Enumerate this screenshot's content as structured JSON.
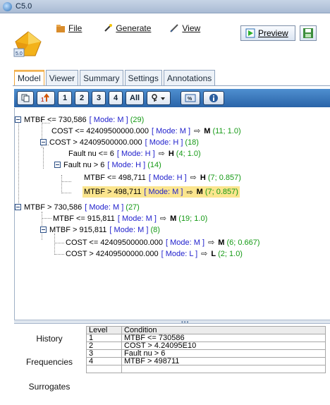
{
  "window": {
    "title": "C5.0"
  },
  "menu": [
    {
      "key": "file",
      "label": "File"
    },
    {
      "key": "generate",
      "label": "Generate"
    },
    {
      "key": "view",
      "label": "View"
    }
  ],
  "toolbar": {
    "preview_label": "Preview"
  },
  "tabs": [
    "Model",
    "Viewer",
    "Summary",
    "Settings",
    "Annotations"
  ],
  "tree_toolbar": {
    "levels": [
      "1",
      "2",
      "3",
      "4",
      "All"
    ]
  },
  "tree": [
    {
      "cond": "MTBF <= 730,586",
      "mode": "[ Mode: M ]",
      "count": "(29)",
      "pred": "",
      "stats": "",
      "expand": true
    },
    {
      "cond": "COST <= 42409500000.000",
      "mode": "[ Mode: M ]",
      "count": "",
      "pred": "M",
      "stats": "(11; 1.0)",
      "expand": false
    },
    {
      "cond": "COST > 42409500000.000",
      "mode": "[ Mode: H ]",
      "count": "(18)",
      "pred": "",
      "stats": "",
      "expand": true
    },
    {
      "cond": "Fault nu <= 6",
      "mode": "[ Mode: H ]",
      "count": "",
      "pred": "H",
      "stats": "(4; 1.0)",
      "expand": false
    },
    {
      "cond": "Fault nu > 6",
      "mode": "[ Mode: H ]",
      "count": "(14)",
      "pred": "",
      "stats": "",
      "expand": true
    },
    {
      "cond": "MTBF <= 498,711",
      "mode": "[ Mode: H ]",
      "count": "",
      "pred": "H",
      "stats": "(7; 0.857)",
      "expand": false
    },
    {
      "cond": "MTBF > 498,711",
      "mode": "[ Mode: M ]",
      "count": "",
      "pred": "M",
      "stats": "(7; 0.857)",
      "expand": false,
      "highlight": true
    },
    {
      "cond": "MTBF > 730,586",
      "mode": "[ Mode: M ]",
      "count": "(27)",
      "pred": "",
      "stats": "",
      "expand": true
    },
    {
      "cond": "MTBF <= 915,811",
      "mode": "[ Mode: M ]",
      "count": "",
      "pred": "M",
      "stats": "(19; 1.0)",
      "expand": false
    },
    {
      "cond": "MTBF > 915,811",
      "mode": "[ Mode: M ]",
      "count": "(8)",
      "pred": "",
      "stats": "",
      "expand": true
    },
    {
      "cond": "COST <= 42409500000.000",
      "mode": "[ Mode: M ]",
      "count": "",
      "pred": "M",
      "stats": "(6; 0.667)",
      "expand": false
    },
    {
      "cond": "COST > 42409500000.000",
      "mode": "[ Mode: L ]",
      "count": "",
      "pred": "L",
      "stats": "(2; 1.0)",
      "expand": false
    }
  ],
  "side_buttons": [
    "History",
    "Frequencies",
    "Surrogates"
  ],
  "table": {
    "headers": [
      "Level",
      "Condition"
    ],
    "rows": [
      [
        "1",
        "MTBF <= 730586"
      ],
      [
        "2",
        "COST > 4.24095E10"
      ],
      [
        "3",
        "Fault nu > 6"
      ],
      [
        "4",
        "MTBF > 498711"
      ],
      [
        "",
        ""
      ]
    ]
  },
  "colors": {
    "mode": "#1f1fcc",
    "count": "#159a15",
    "highlight": "#fbe58e",
    "tab_active": "#f0a73a"
  }
}
